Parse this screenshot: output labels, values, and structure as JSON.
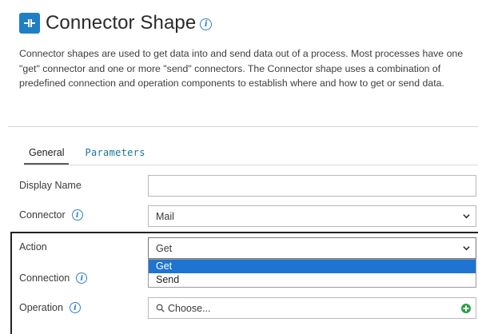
{
  "header": {
    "title": "Connector Shape",
    "icon": "connector-shape-icon",
    "accent_color": "#1f7fc4"
  },
  "description": "Connector shapes are used to get data into and send data out of a process. Most processes have one \"get\" connector and one or more \"send\" connectors. The Connector shape uses a combination of predefined connection and operation components to establish where and how to get or send data.",
  "tabs": [
    {
      "label": "General",
      "active": true
    },
    {
      "label": "Parameters",
      "active": false
    }
  ],
  "form": {
    "display_name": {
      "label": "Display Name",
      "value": ""
    },
    "connector": {
      "label": "Connector",
      "value": "Mail"
    },
    "action": {
      "label": "Action",
      "value": "Get",
      "options": [
        "Get",
        "Send"
      ],
      "selected": "Get"
    },
    "connection": {
      "label": "Connection"
    },
    "operation": {
      "label": "Operation",
      "placeholder": "Choose..."
    }
  },
  "colors": {
    "tab_link": "#1a7393",
    "selected_option": "#1e74d1",
    "add_button": "#2e9e43"
  }
}
